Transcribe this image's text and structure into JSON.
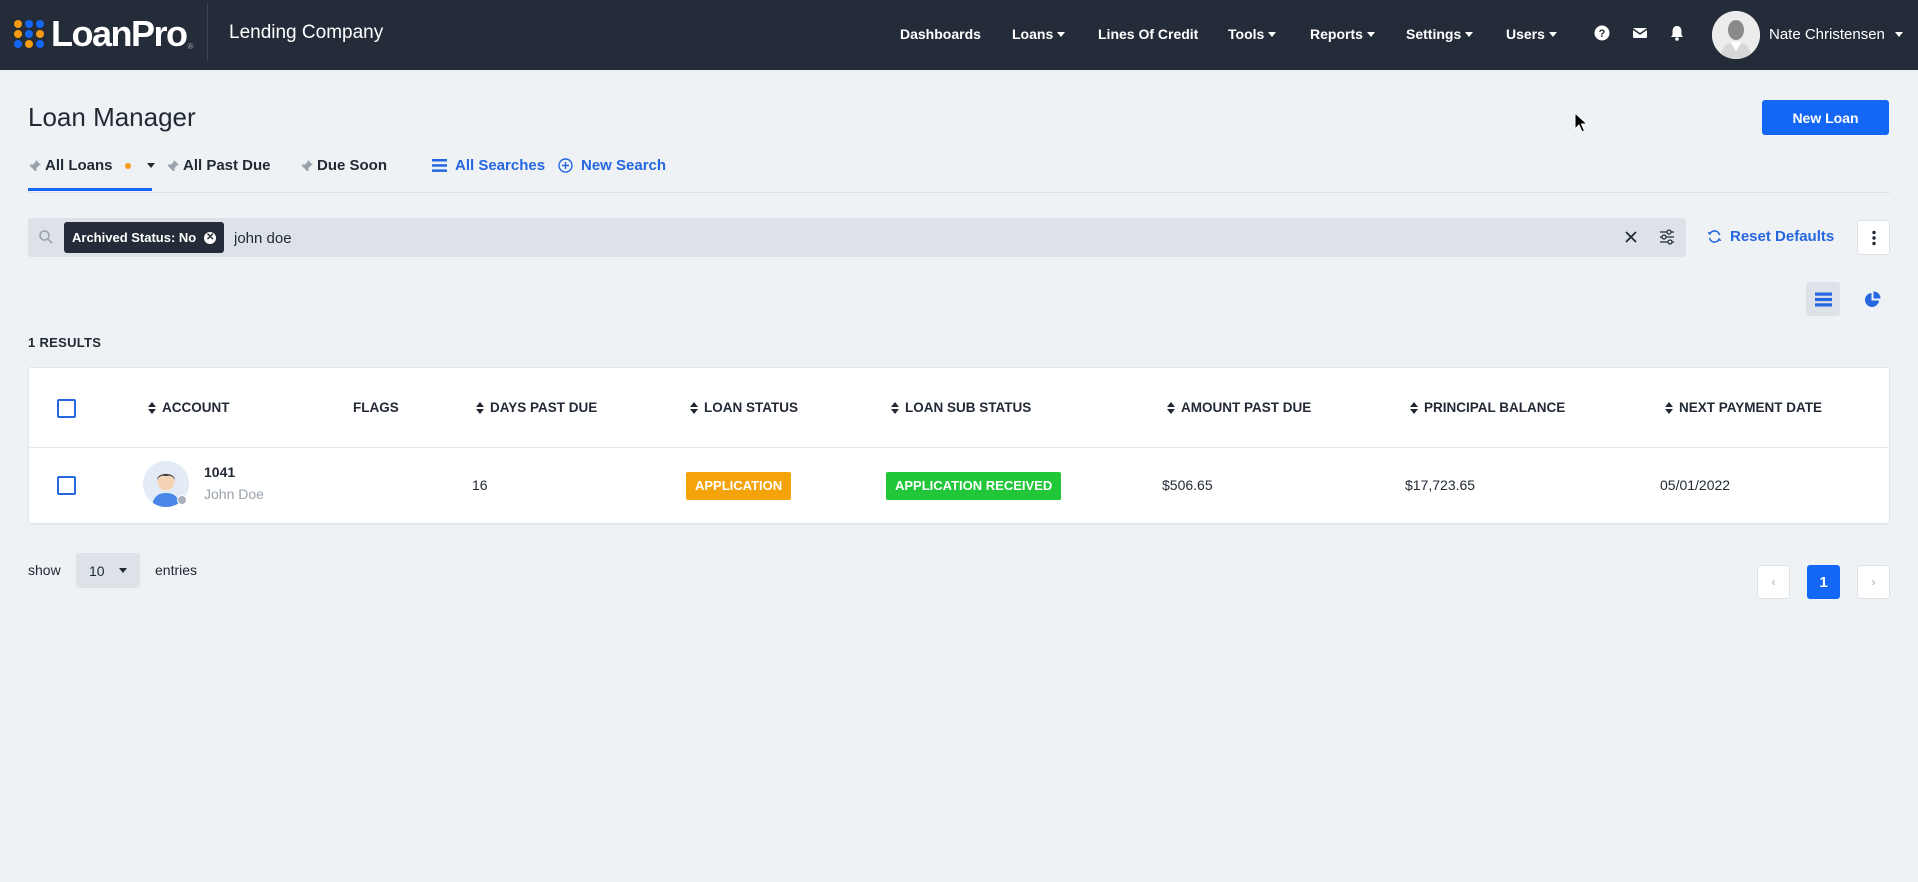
{
  "brand": {
    "logo_text": "LoanPro",
    "logo_reg": "®",
    "dot_colors": [
      "#f39c12",
      "#1467f5",
      "#f39c12",
      "#1467f5",
      "#f39c12",
      "#1467f5",
      "#f39c12",
      "#1467f5",
      "#f39c12"
    ],
    "company": "Lending Company"
  },
  "nav": {
    "dashboards": "Dashboards",
    "loans": "Loans",
    "lines_of_credit": "Lines Of Credit",
    "tools": "Tools",
    "reports": "Reports",
    "settings": "Settings",
    "users": "Users",
    "icons": [
      "help-icon",
      "mail-icon",
      "bell-icon"
    ]
  },
  "user": {
    "name": "Nate Christensen"
  },
  "page": {
    "title": "Loan Manager",
    "new_loan_label": "New Loan"
  },
  "tabs": {
    "all_loans": "All Loans",
    "all_past_due": "All Past Due",
    "due_soon": "Due Soon",
    "all_searches": "All Searches",
    "new_search": "New Search"
  },
  "search": {
    "chip_label": "Archived Status: No",
    "query": "john doe",
    "reset_label": "Reset Defaults"
  },
  "results": {
    "count_label": "1 RESULTS"
  },
  "table": {
    "headers": {
      "account": "ACCOUNT",
      "flags": "FLAGS",
      "days_past_due": "DAYS PAST DUE",
      "loan_status": "LOAN STATUS",
      "loan_sub_status": "LOAN SUB STATUS",
      "amount_past_due": "AMOUNT PAST DUE",
      "principal_balance": "PRINCIPAL BALANCE",
      "next_payment_date": "NEXT PAYMENT DATE"
    },
    "rows": [
      {
        "account_id": "1041",
        "name": "John Doe",
        "flags": "",
        "days_past_due": "16",
        "loan_status": "APPLICATION",
        "loan_status_color": "#f5a30a",
        "loan_sub_status": "APPLICATION RECEIVED",
        "loan_sub_status_color": "#21c739",
        "amount_past_due": "$506.65",
        "principal_balance": "$17,723.65",
        "next_payment_date": "05/01/2022"
      }
    ]
  },
  "footer": {
    "show_label": "show",
    "entries_value": "10",
    "entries_label": "entries",
    "prev": "‹",
    "current_page": "1",
    "next": "›"
  },
  "colors": {
    "navbar_bg": "#242c39",
    "accent_blue": "#1467f5",
    "link_blue": "#2467e0",
    "page_bg": "#eff2f5"
  }
}
